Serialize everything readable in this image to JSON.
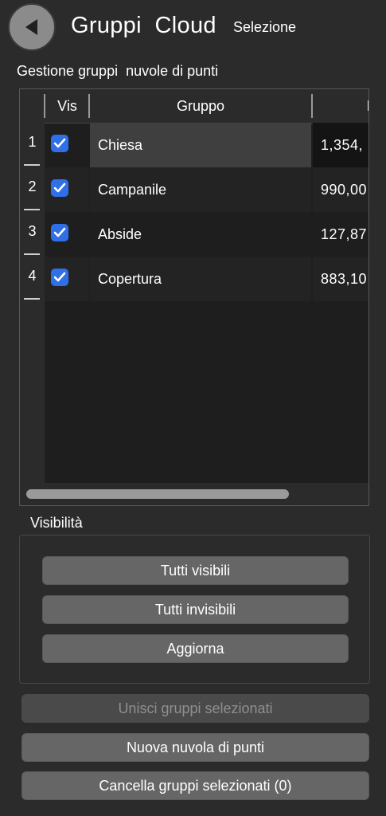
{
  "header": {
    "back_icon": "back-arrow-icon",
    "title": "Gruppi  Cloud",
    "subtitle": "Selezione"
  },
  "section_label": "Gestione gruppi  nuvole di punti",
  "table": {
    "columns": [
      "Vis",
      "Gruppo",
      "I"
    ],
    "rows": [
      {
        "index": "1",
        "visible": true,
        "name": "Chiesa",
        "count": "1,354,",
        "selected": true
      },
      {
        "index": "2",
        "visible": true,
        "name": "Campanile",
        "count": "990,00",
        "selected": false
      },
      {
        "index": "3",
        "visible": true,
        "name": "Abside",
        "count": "127,87",
        "selected": false
      },
      {
        "index": "4",
        "visible": true,
        "name": "Copertura",
        "count": "883,10",
        "selected": false
      }
    ]
  },
  "visibility": {
    "label": "Visibilità",
    "all_visible": "Tutti visibili",
    "all_invisible": "Tutti invisibili",
    "refresh": "Aggiorna"
  },
  "actions": {
    "merge": "Unisci gruppi selezionati",
    "new_cloud": "Nuova nuvola di punti",
    "delete": "Cancella gruppi selezionati (0)"
  },
  "colors": {
    "background": "#2b2b2b",
    "checkbox": "#2f6fe8",
    "button": "#666666"
  }
}
